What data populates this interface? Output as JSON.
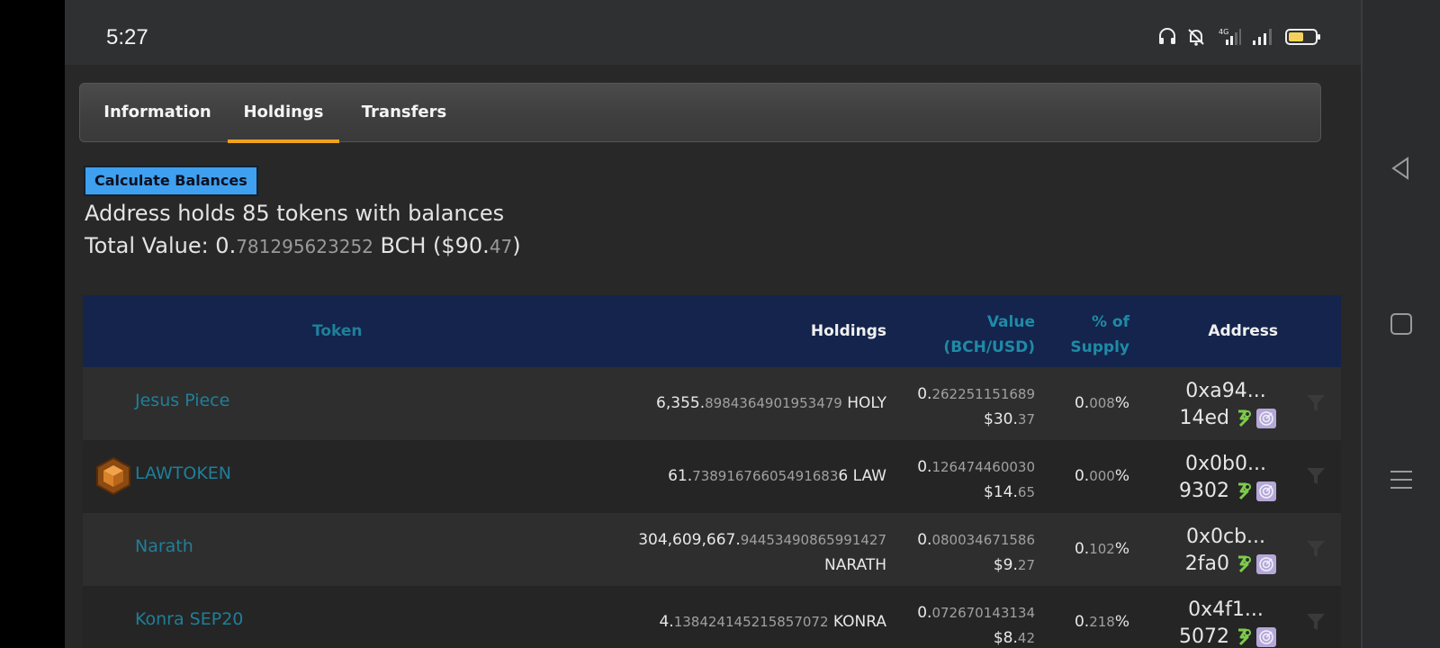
{
  "status_bar": {
    "time": "5:27",
    "network": "4G",
    "icons": [
      "headphones-icon",
      "bell-muted-icon",
      "signal-4g-icon",
      "signal-icon",
      "battery-icon"
    ]
  },
  "nav": {
    "icons": [
      "back-icon",
      "home-icon",
      "menu-icon"
    ]
  },
  "tabs": [
    {
      "label": "Information",
      "active": false
    },
    {
      "label": "Holdings",
      "active": true
    },
    {
      "label": "Transfers",
      "active": false
    }
  ],
  "accent_color": "#f0a11e",
  "summary": {
    "calculate_button": "Calculate Balances",
    "holds_text": "Address holds 85 tokens with balances",
    "total_prefix": "Total Value: 0.",
    "total_bch_frac": "781295623252",
    "total_mid": " BCH ($90.",
    "total_usd_frac": "47",
    "total_suffix": ")"
  },
  "table": {
    "headers": {
      "token": "Token",
      "holdings": "Holdings",
      "value_line1": "Value",
      "value_line2": "(BCH/USD)",
      "supply_line1": "% of",
      "supply_line2": "Supply",
      "address": "Address"
    },
    "rows": [
      {
        "token": "Jesus Piece",
        "has_logo": false,
        "holdings_int": "6,355.",
        "holdings_frac": "8984364901953479",
        "holdings_sym": " HOLY",
        "bch_int": "0.",
        "bch_frac": "262251151689",
        "usd_int": "$30.",
        "usd_frac": "37",
        "supply_int": "0.",
        "supply_frac": "008",
        "supply_pct": "%",
        "addr_start": "0xa94...",
        "addr_end": "14ed"
      },
      {
        "token": "LAWTOKEN",
        "has_logo": true,
        "holdings_int": "61.",
        "holdings_frac": "73891676605491683",
        "holdings_sym": "6 LAW",
        "bch_int": "0.",
        "bch_frac": "126474460030",
        "usd_int": "$14.",
        "usd_frac": "65",
        "supply_int": "0.",
        "supply_frac": "000",
        "supply_pct": "%",
        "addr_start": "0x0b0...",
        "addr_end": "9302"
      },
      {
        "token": "Narath",
        "has_logo": false,
        "holdings_int": "304,609,667.",
        "holdings_frac": "94453490865991427",
        "holdings_sym": "NARATH",
        "bch_int": "0.",
        "bch_frac": "080034671586",
        "usd_int": "$9.",
        "usd_frac": "27",
        "supply_int": "0.",
        "supply_frac": "102",
        "supply_pct": "%",
        "addr_start": "0x0cb...",
        "addr_end": "2fa0"
      },
      {
        "token": "Konra SEP20",
        "has_logo": false,
        "holdings_int": "4.",
        "holdings_frac": "138424145215857072",
        "holdings_sym": " KONRA",
        "bch_int": "0.",
        "bch_frac": "072670143134",
        "usd_int": "$8.",
        "usd_frac": "42",
        "supply_int": "0.",
        "supply_frac": "218",
        "supply_pct": "%",
        "addr_start": "0x4f1...",
        "addr_end": "5072"
      }
    ]
  }
}
